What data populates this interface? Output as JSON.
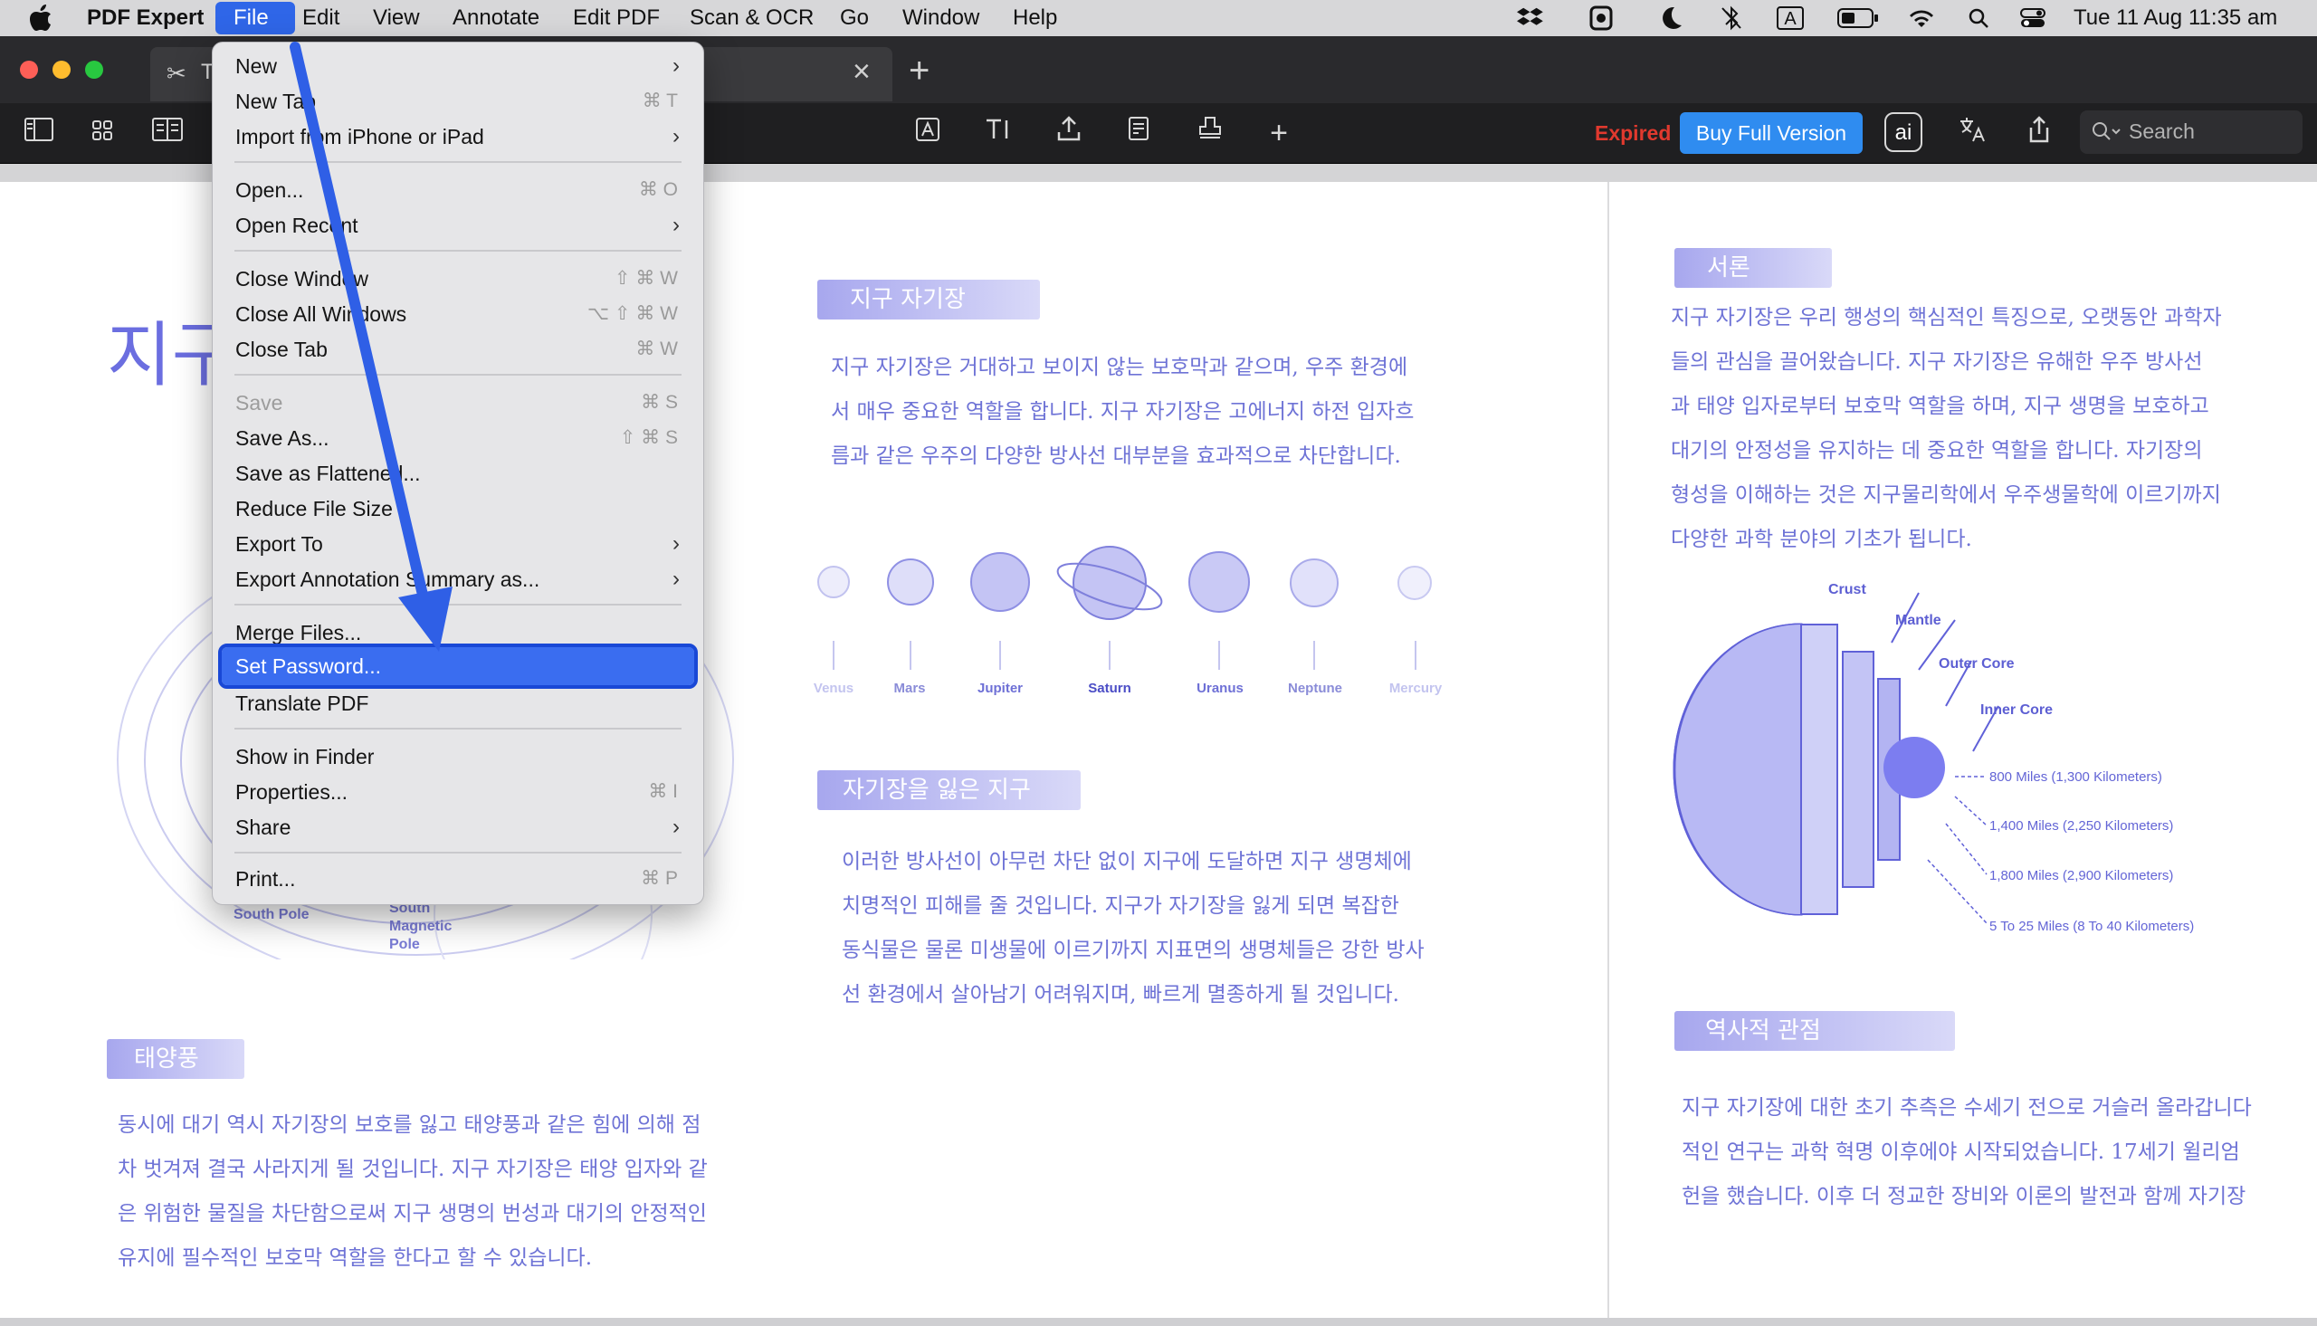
{
  "menubar": {
    "apple": "",
    "app_name": "PDF Expert",
    "items": [
      "File",
      "Edit",
      "View",
      "Annotate",
      "Edit PDF",
      "Scan & OCR",
      "Go",
      "Window",
      "Help"
    ],
    "status_icons": [
      "dropbox-icon",
      "shield-icon",
      "moon-icon",
      "bluetooth-off-icon",
      "keyboard-a-icon",
      "battery-icon",
      "wifi-icon",
      "search-icon",
      "control-center-icon"
    ],
    "keyboard_label": "A",
    "date": "Tue 11 Aug",
    "time": "11:35 am"
  },
  "tabs": {
    "tab_title": "T",
    "new_tab": "+",
    "close": "×"
  },
  "toolbar": {
    "expired": "Expired",
    "buy_button": "Buy Full Version",
    "ai_label": "ai",
    "search_placeholder": "Search",
    "colors": {
      "expired": "#e0392e",
      "buy_button": "#2f8cf0"
    }
  },
  "file_menu": {
    "items": [
      {
        "label": "New",
        "submenu": true
      },
      {
        "label": "New Tab",
        "shortcut": "⌘ T"
      },
      {
        "label": "Import from iPhone or iPad",
        "submenu": true
      },
      {
        "label": "Open...",
        "shortcut": "⌘ O"
      },
      {
        "label": "Open Recent",
        "submenu": true
      },
      {
        "label": "Close Window",
        "shortcut": "⇧ ⌘ W"
      },
      {
        "label": "Close All Windows",
        "shortcut": "⌥ ⇧ ⌘ W"
      },
      {
        "label": "Close Tab",
        "shortcut": "⌘ W"
      },
      {
        "label": "Save",
        "shortcut": "⌘ S",
        "disabled": true
      },
      {
        "label": "Save As...",
        "shortcut": "⇧ ⌘ S"
      },
      {
        "label": "Save as Flattened..."
      },
      {
        "label": "Reduce File Size"
      },
      {
        "label": "Export To",
        "submenu": true
      },
      {
        "label": "Export Annotation Summary as...",
        "submenu": true
      },
      {
        "label": "Merge Files..."
      },
      {
        "label": "Set Password...",
        "highlighted": true
      },
      {
        "label": "Translate PDF"
      },
      {
        "label": "Show in Finder"
      },
      {
        "label": "Properties...",
        "shortcut": "⌘ I"
      },
      {
        "label": "Share",
        "submenu": true
      },
      {
        "label": "Print...",
        "shortcut": "⌘ P"
      }
    ],
    "chevron": "›"
  },
  "doc": {
    "left_title": "지구",
    "heading1": "지구 자기장",
    "para1": [
      "지구 자기장은 거대하고 보이지 않는 보호막과 같으며, 우주 환경에",
      "서 매우 중요한 역할을 합니다. 지구 자기장은 고에너지 하전 입자흐",
      "름과 같은 우주의 다양한 방사선 대부분을 효과적으로 차단합니다."
    ],
    "planets": [
      "Venus",
      "Mars",
      "Jupiter",
      "Saturn",
      "Uranus",
      "Neptune",
      "Mercury"
    ],
    "heading2": "자기장을 잃은 지구",
    "para2": [
      "이러한 방사선이 아무런 차단 없이 지구에 도달하면 지구 생명체에",
      "치명적인 피해를 줄 것입니다. 지구가 자기장을 잃게 되면 복잡한",
      "동식물은 물론 미생물에 이르기까지 지표면의 생명체들은 강한 방사",
      "선 환경에서 살아남기 어려워지며, 빠르게 멸종하게 될 것입니다."
    ],
    "heading3": "태양풍",
    "para3": [
      "동시에 대기 역시 자기장의 보호를 잃고 태양풍과 같은 힘에 의해 점",
      "차 벗겨져 결국 사라지게 될 것입니다. 지구 자기장은 태양 입자와 같",
      "은 위험한 물질을 차단함으로써 지구 생명의 번성과 대기의 안정적인",
      "유지에 필수적인 보호막 역할을 한다고 할 수 있습니다."
    ],
    "south_pole": "South Pole",
    "south_magnetic_pole": [
      "South",
      "Magnetic",
      "Pole"
    ],
    "heading4": "서론",
    "para4": [
      "지구 자기장은 우리 행성의 핵심적인 특징으로, 오랫동안 과학자",
      "들의 관심을 끌어왔습니다. 지구 자기장은 유해한 우주 방사선",
      "과 태양 입자로부터 보호막 역할을 하며, 지구 생명을 보호하고",
      "대기의 안정성을 유지하는 데 중요한 역할을 합니다. 자기장의",
      "형성을 이해하는 것은 지구물리학에서 우주생물학에 이르기까지",
      "다양한 과학 분야의 기초가 됩니다."
    ],
    "earth_labels": [
      "Crust",
      "Mantle",
      "Outer Core",
      "Inner Core"
    ],
    "depths": [
      "800 Miles (1,300 Kilometers)",
      "1,400 Miles (2,250 Kilometers)",
      "1,800 Miles (2,900 Kilometers)",
      "5 To 25 Miles (8 To 40 Kilometers)"
    ],
    "heading5": "역사적 관점",
    "para5": [
      "지구 자기장에 대한 초기 추측은 수세기 전으로 거슬러 올라갑니다",
      "적인 연구는 과학 혁명 이후에야 시작되었습니다. 17세기 윌리엄",
      "헌을 했습니다. 이후 더 정교한 장비와 이론의 발전과 함께 자기장"
    ]
  }
}
